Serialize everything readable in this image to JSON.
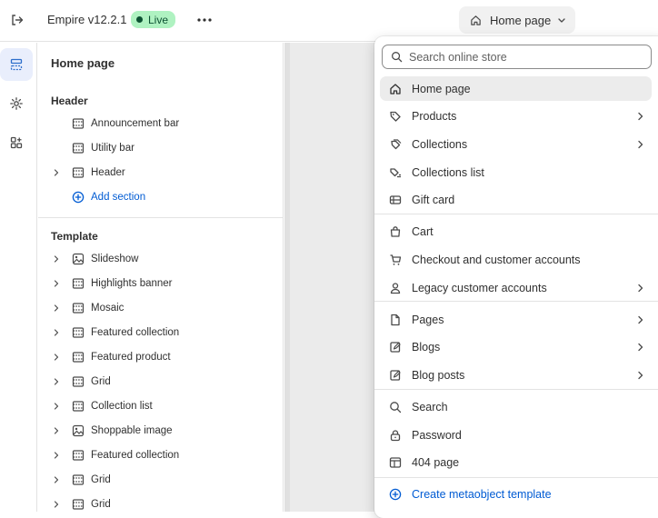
{
  "topbar": {
    "theme_name": "Empire v12.2.1",
    "live_badge": "Live",
    "page_selector": "Home page"
  },
  "panel": {
    "title": "Home page",
    "header_section": {
      "heading": "Header",
      "items": [
        {
          "label": "Announcement bar",
          "icon": "section-icon",
          "expandable": false
        },
        {
          "label": "Utility bar",
          "icon": "section-icon",
          "expandable": false
        },
        {
          "label": "Header",
          "icon": "section-icon",
          "expandable": true
        }
      ],
      "add_label": "Add section"
    },
    "template_section": {
      "heading": "Template",
      "items": [
        {
          "label": "Slideshow",
          "icon": "image-section-icon"
        },
        {
          "label": "Highlights banner",
          "icon": "section-icon"
        },
        {
          "label": "Mosaic",
          "icon": "section-icon"
        },
        {
          "label": "Featured collection",
          "icon": "section-icon"
        },
        {
          "label": "Featured product",
          "icon": "section-icon"
        },
        {
          "label": "Grid",
          "icon": "section-icon"
        },
        {
          "label": "Collection list",
          "icon": "section-icon"
        },
        {
          "label": "Shoppable image",
          "icon": "image-section-icon"
        },
        {
          "label": "Featured collection",
          "icon": "section-icon"
        },
        {
          "label": "Grid",
          "icon": "section-icon"
        },
        {
          "label": "Grid",
          "icon": "section-icon"
        }
      ]
    }
  },
  "dropdown": {
    "search_placeholder": "Search online store",
    "items": [
      {
        "label": "Home page",
        "icon": "home-icon",
        "submenu": false,
        "selected": true
      },
      {
        "label": "Products",
        "icon": "tag-icon",
        "submenu": true
      },
      {
        "label": "Collections",
        "icon": "collection-icon",
        "submenu": true
      },
      {
        "label": "Collections list",
        "icon": "collection-list-icon",
        "submenu": false
      },
      {
        "label": "Gift card",
        "icon": "gift-card-icon",
        "submenu": false
      },
      {
        "label": "Cart",
        "icon": "bag-icon",
        "submenu": false
      },
      {
        "label": "Checkout and customer accounts",
        "icon": "cart-icon",
        "submenu": false
      },
      {
        "label": "Legacy customer accounts",
        "icon": "person-icon",
        "submenu": true
      },
      {
        "label": "Pages",
        "icon": "page-icon",
        "submenu": true
      },
      {
        "label": "Blogs",
        "icon": "blog-icon",
        "submenu": true
      },
      {
        "label": "Blog posts",
        "icon": "blog-icon",
        "submenu": true
      },
      {
        "label": "Search",
        "icon": "search-icon",
        "submenu": false
      },
      {
        "label": "Password",
        "icon": "lock-icon",
        "submenu": false
      },
      {
        "label": "404 page",
        "icon": "error-page-icon",
        "submenu": false
      }
    ],
    "create_label": "Create metaobject template"
  },
  "colors": {
    "accent": "#005bd3",
    "live_badge_bg": "#aff2c1",
    "live_badge_text": "#0c5132"
  }
}
